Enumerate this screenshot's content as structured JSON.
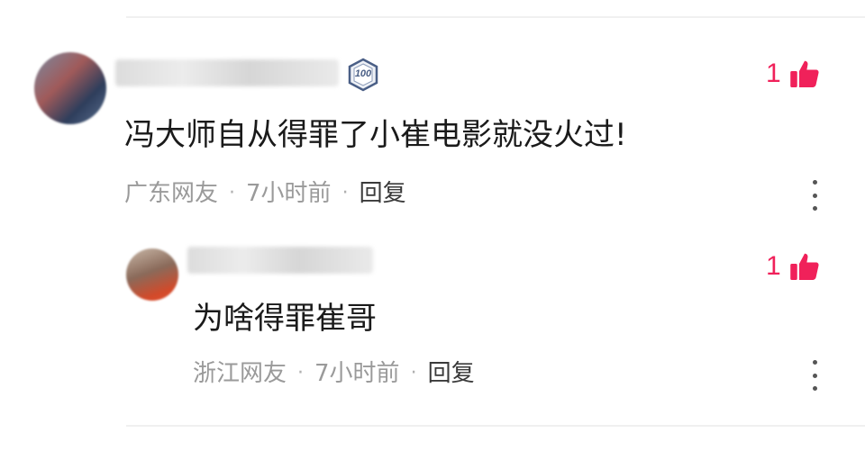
{
  "colors": {
    "like": "#f0215a",
    "meta": "#9a9a9a",
    "text": "#1a1a1a",
    "reply_action": "#3a3a3a"
  },
  "comments": [
    {
      "badge": "100",
      "text": "冯大师自从得罪了小崔电影就没火过!",
      "likes": "1",
      "location": "广东网友",
      "time": "7小时前",
      "reply_label": "回复",
      "more_icon": "more-vertical-icon",
      "like_icon": "thumbs-up-icon"
    },
    {
      "text": "为啥得罪崔哥",
      "likes": "1",
      "location": "浙江网友",
      "time": "7小时前",
      "reply_label": "回复",
      "more_icon": "more-vertical-icon",
      "like_icon": "thumbs-up-icon"
    }
  ]
}
